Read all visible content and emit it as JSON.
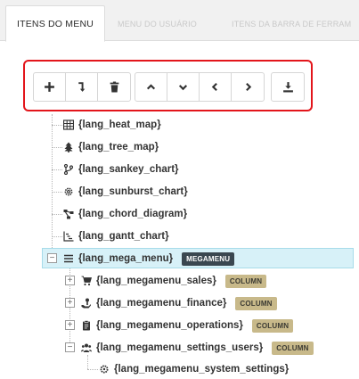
{
  "tabs": [
    {
      "label": "ITENS DO MENU",
      "active": true
    },
    {
      "label": "MENU DO USUÁRIO",
      "active": false
    },
    {
      "label": "ITENS DA BARRA DE FERRAM",
      "active": false
    }
  ],
  "toolbar": {
    "buttons": [
      "add-icon",
      "indent-icon",
      "trash-icon",
      "chevron-up-icon",
      "chevron-down-icon",
      "chevron-left-icon",
      "chevron-right-icon",
      "download-icon"
    ]
  },
  "tree": {
    "items": [
      {
        "label": "{lang_heat_map}",
        "icon": "table-icon"
      },
      {
        "label": "{lang_tree_map}",
        "icon": "tree-icon"
      },
      {
        "label": "{lang_sankey_chart}",
        "icon": "code-branch-icon"
      },
      {
        "label": "{lang_sunburst_chart}",
        "icon": "cog-icon"
      },
      {
        "label": "{lang_chord_diagram}",
        "icon": "sitemap-icon"
      },
      {
        "label": "{lang_gantt_chart}",
        "icon": "gantt-icon"
      },
      {
        "label": "{lang_mega_menu}",
        "icon": "list-icon",
        "badge": "MEGAMENU",
        "selected": true,
        "toggle": "−"
      },
      {
        "label": "{lang_megamenu_sales}",
        "icon": "cart-icon",
        "badge": "COLUMN",
        "toggle": "+"
      },
      {
        "label": "{lang_megamenu_finance}",
        "icon": "hand-coin-icon",
        "badge": "COLUMN",
        "toggle": "+"
      },
      {
        "label": "{lang_megamenu_operations}",
        "icon": "clipboard-icon",
        "badge": "COLUMN",
        "toggle": "+"
      },
      {
        "label": "{lang_megamenu_settings_users}",
        "icon": "users-icon",
        "badge": "COLUMN",
        "toggle": "−"
      },
      {
        "label": "{lang_megamenu_system_settings}",
        "icon": "cog-icon"
      }
    ]
  },
  "colors": {
    "highlight_border": "#e3151b",
    "selected_bg": "#d7f1f8",
    "megamenu_badge": "#3a4750",
    "column_badge": "#c8b98a"
  }
}
